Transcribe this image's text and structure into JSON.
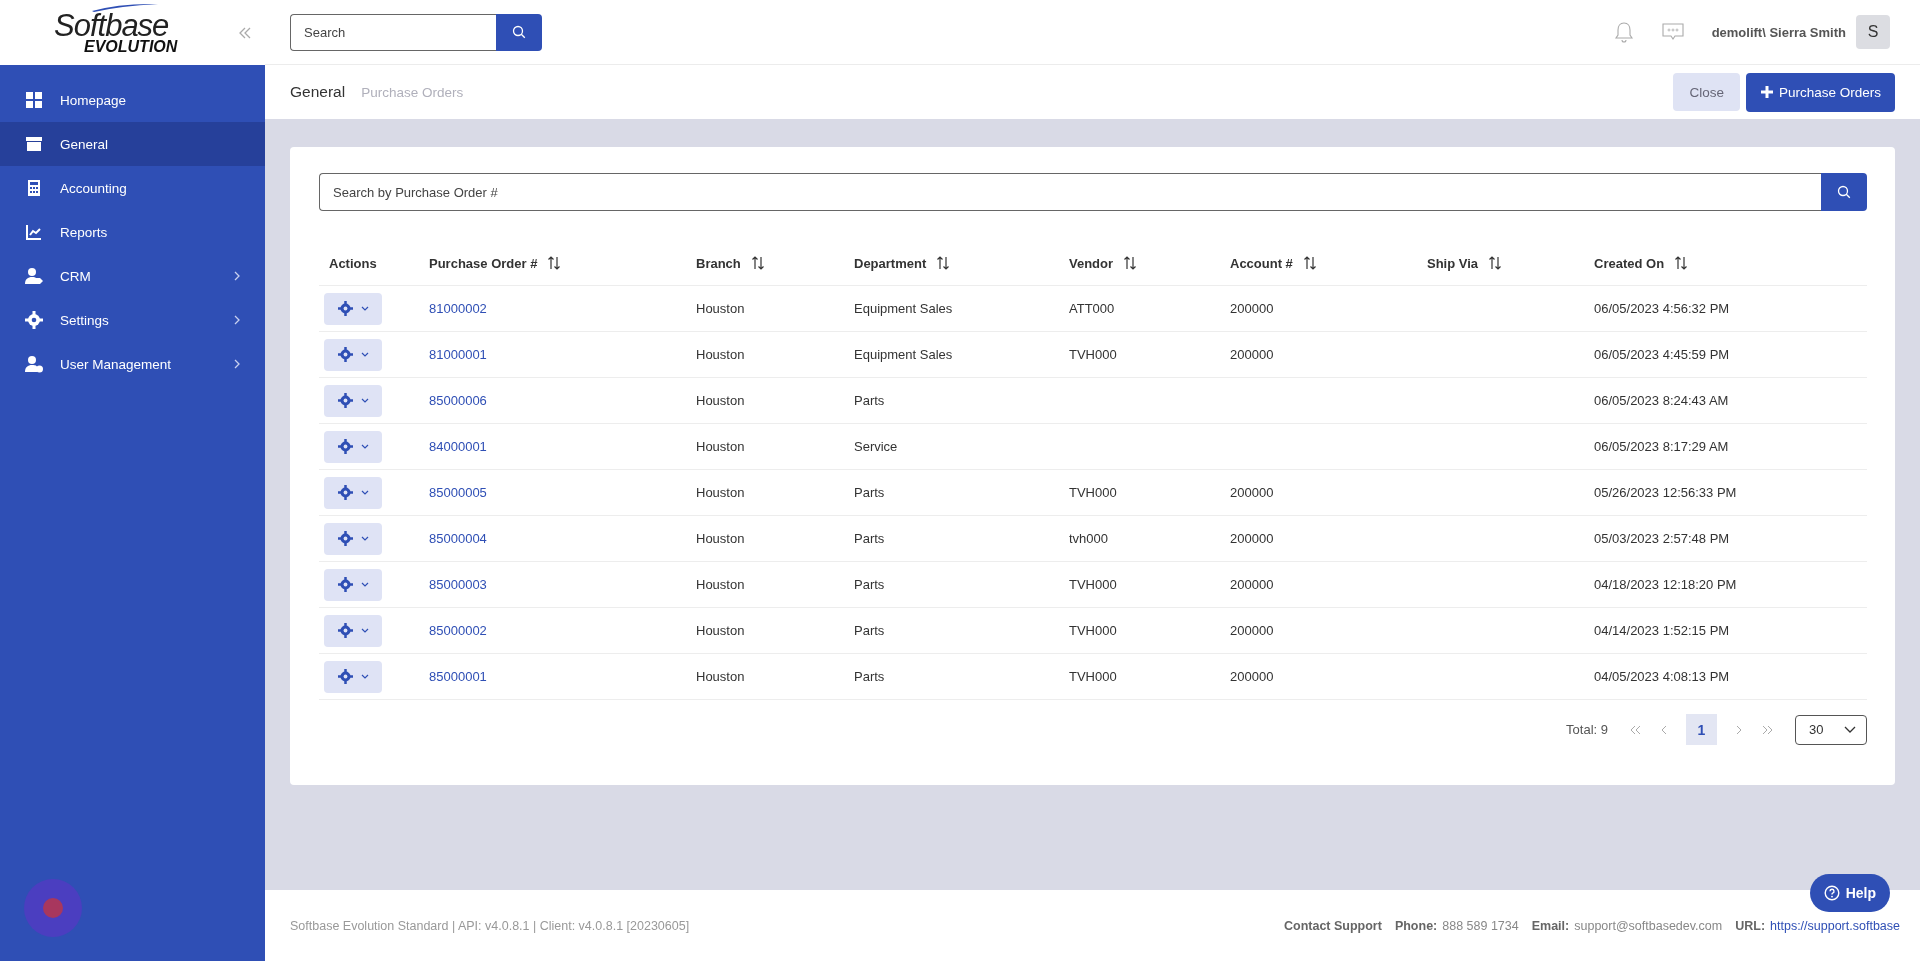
{
  "logo": {
    "name": "Softbase",
    "sub": "EVOLUTION"
  },
  "sidebar": {
    "items": [
      {
        "label": "Homepage",
        "selected": false,
        "has_submenu": false
      },
      {
        "label": "General",
        "selected": true,
        "has_submenu": false
      },
      {
        "label": "Accounting",
        "selected": false,
        "has_submenu": false
      },
      {
        "label": "Reports",
        "selected": false,
        "has_submenu": false
      },
      {
        "label": "CRM",
        "selected": false,
        "has_submenu": true
      },
      {
        "label": "Settings",
        "selected": false,
        "has_submenu": true
      },
      {
        "label": "User Management",
        "selected": false,
        "has_submenu": true
      }
    ]
  },
  "topbar": {
    "search": {
      "placeholder": "Search"
    },
    "user": "demolift\\ Sierra Smith",
    "avatar": "S"
  },
  "breadcrumb": [
    "General",
    "Purchase Orders"
  ],
  "actions": {
    "close": "Close",
    "add": "Purchase Orders"
  },
  "table": {
    "search": {
      "placeholder": "Search by Purchase Order #"
    },
    "columns": [
      {
        "label": "Actions",
        "sortable": false
      },
      {
        "label": "Purchase Order #",
        "sortable": true
      },
      {
        "label": "Branch",
        "sortable": true
      },
      {
        "label": "Department",
        "sortable": true
      },
      {
        "label": "Vendor",
        "sortable": true
      },
      {
        "label": "Account #",
        "sortable": true
      },
      {
        "label": "Ship Via",
        "sortable": true
      },
      {
        "label": "Created On",
        "sortable": true
      }
    ],
    "rows": [
      {
        "po": "81000002",
        "branch": "Houston",
        "department": "Equipment Sales",
        "vendor": "ATT000",
        "account": "200000",
        "ship_via": "",
        "created": "06/05/2023 4:56:32 PM"
      },
      {
        "po": "81000001",
        "branch": "Houston",
        "department": "Equipment Sales",
        "vendor": "TVH000",
        "account": "200000",
        "ship_via": "",
        "created": "06/05/2023 4:45:59 PM"
      },
      {
        "po": "85000006",
        "branch": "Houston",
        "department": "Parts",
        "vendor": "",
        "account": "",
        "ship_via": "",
        "created": "06/05/2023 8:24:43 AM"
      },
      {
        "po": "84000001",
        "branch": "Houston",
        "department": "Service",
        "vendor": "",
        "account": "",
        "ship_via": "",
        "created": "06/05/2023 8:17:29 AM"
      },
      {
        "po": "85000005",
        "branch": "Houston",
        "department": "Parts",
        "vendor": "TVH000",
        "account": "200000",
        "ship_via": "",
        "created": "05/26/2023 12:56:33 PM"
      },
      {
        "po": "85000004",
        "branch": "Houston",
        "department": "Parts",
        "vendor": "tvh000",
        "account": "200000",
        "ship_via": "",
        "created": "05/03/2023 2:57:48 PM"
      },
      {
        "po": "85000003",
        "branch": "Houston",
        "department": "Parts",
        "vendor": "TVH000",
        "account": "200000",
        "ship_via": "",
        "created": "04/18/2023 12:18:20 PM"
      },
      {
        "po": "85000002",
        "branch": "Houston",
        "department": "Parts",
        "vendor": "TVH000",
        "account": "200000",
        "ship_via": "",
        "created": "04/14/2023 1:52:15 PM"
      },
      {
        "po": "85000001",
        "branch": "Houston",
        "department": "Parts",
        "vendor": "TVH000",
        "account": "200000",
        "ship_via": "",
        "created": "04/05/2023 4:08:13 PM"
      }
    ]
  },
  "pagination": {
    "total": "Total: 9",
    "pages": [
      {
        "label": "1",
        "selected": true
      }
    ],
    "page_size": "30"
  },
  "footer": {
    "version": "Softbase Evolution Standard | API: v4.0.8.1 | Client: v4.0.8.1 [20230605]",
    "contacts": [
      {
        "label": "Contact Support"
      },
      {
        "label": "Phone:",
        "value": "888 589 1734"
      },
      {
        "label": "Email:",
        "value": "support@softbasedev.com"
      },
      {
        "label": "URL:",
        "value": "https://support.softbase",
        "link": true
      }
    ]
  },
  "help": "Help"
}
